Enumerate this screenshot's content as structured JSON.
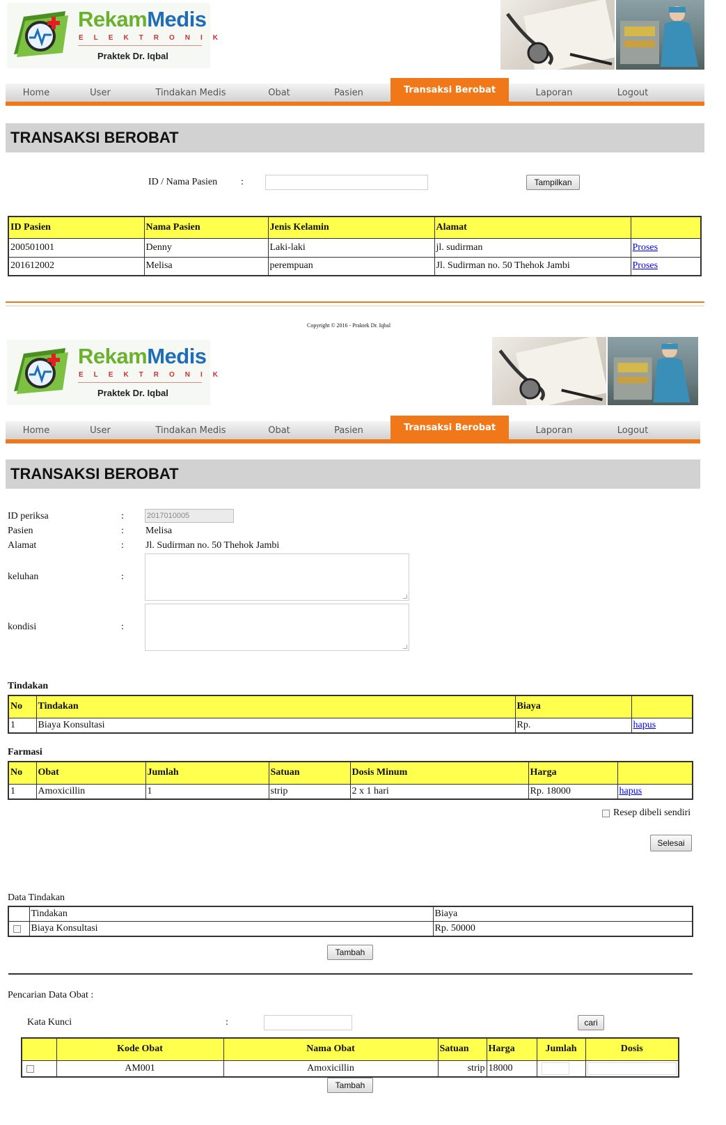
{
  "brand": {
    "title_part1": "Rekam",
    "title_part2": "Medis",
    "subtitle": "ELEKTRONIK",
    "praktek": "Praktek Dr. Iqbal"
  },
  "nav": [
    {
      "label": "Home"
    },
    {
      "label": "User"
    },
    {
      "label": "Tindakan Medis"
    },
    {
      "label": "Obat"
    },
    {
      "label": "Pasien"
    },
    {
      "label": "Transaksi Berobat"
    },
    {
      "label": "Laporan"
    },
    {
      "label": "Logout"
    }
  ],
  "colors": {
    "accent": "#f07818",
    "header_yellow": "#ffff4d",
    "brand_green": "#6ab12e",
    "brand_blue": "#1e6db6"
  },
  "page_title": "TRANSAKSI BEROBAT",
  "search": {
    "label": "ID / Nama Pasien",
    "colon": ":",
    "value": "",
    "button": "Tampilkan"
  },
  "patients": {
    "headers": [
      "ID Pasien",
      "Nama Pasien",
      "Jenis Kelamin",
      "Alamat",
      ""
    ],
    "rows": [
      {
        "id": "200501001",
        "nama": "Denny",
        "jk": "Laki-laki",
        "alamat": "jl. sudirman",
        "action": "Proses"
      },
      {
        "id": "201612002",
        "nama": "Melisa",
        "jk": "perempuan",
        "alamat": "Jl. Sudirman no. 50 Thehok Jambi",
        "action": "Proses"
      }
    ]
  },
  "footer": {
    "copyright": "Copyright © 2016 - Praktek Dr. Iqbal"
  },
  "form": {
    "id_label": "ID periksa",
    "id_value": "2017010005",
    "pasien_label": "Pasien",
    "pasien_value": "Melisa",
    "alamat_label": "Alamat",
    "alamat_value": "Jl. Sudirman no. 50 Thehok Jambi",
    "keluhan_label": "keluhan",
    "kondisi_label": "kondisi",
    "colon": ":"
  },
  "tindakan": {
    "title": "Tindakan",
    "headers": [
      "No",
      "Tindakan",
      "Biaya",
      ""
    ],
    "rows": [
      {
        "no": "1",
        "tindakan": "Biaya Konsultasi",
        "biaya": "Rp.",
        "action": "hapus"
      }
    ]
  },
  "farmasi": {
    "title": "Farmasi",
    "headers": [
      "No",
      "Obat",
      "Jumlah",
      "Satuan",
      "Dosis Minum",
      "Harga",
      ""
    ],
    "rows": [
      {
        "no": "1",
        "obat": "Amoxicillin",
        "jumlah": "1",
        "satuan": "strip",
        "dosis": "2 x 1 hari",
        "harga": "Rp. 18000",
        "action": "hapus"
      }
    ]
  },
  "resep_label": "Resep dibeli sendiri",
  "selesai_button": "Selesai",
  "data_tindakan": {
    "title": "Data Tindakan",
    "headers": [
      "Tindakan",
      "Biaya"
    ],
    "rows": [
      {
        "tindakan": "Biaya Konsultasi",
        "biaya": "Rp. 50000"
      }
    ],
    "button": "Tambah"
  },
  "pencarian_obat": {
    "title": "Pencarian Data Obat :",
    "kata_kunci_label": "Kata Kunci",
    "colon": ":",
    "value": "",
    "button": "cari",
    "headers": [
      "",
      "Kode Obat",
      "Nama Obat",
      "Satuan",
      "Harga",
      "Jumlah",
      "Dosis"
    ],
    "rows": [
      {
        "kode": "AM001",
        "nama": "Amoxicillin",
        "satuan": "strip",
        "harga": "18000"
      }
    ],
    "tambah_button": "Tambah"
  }
}
